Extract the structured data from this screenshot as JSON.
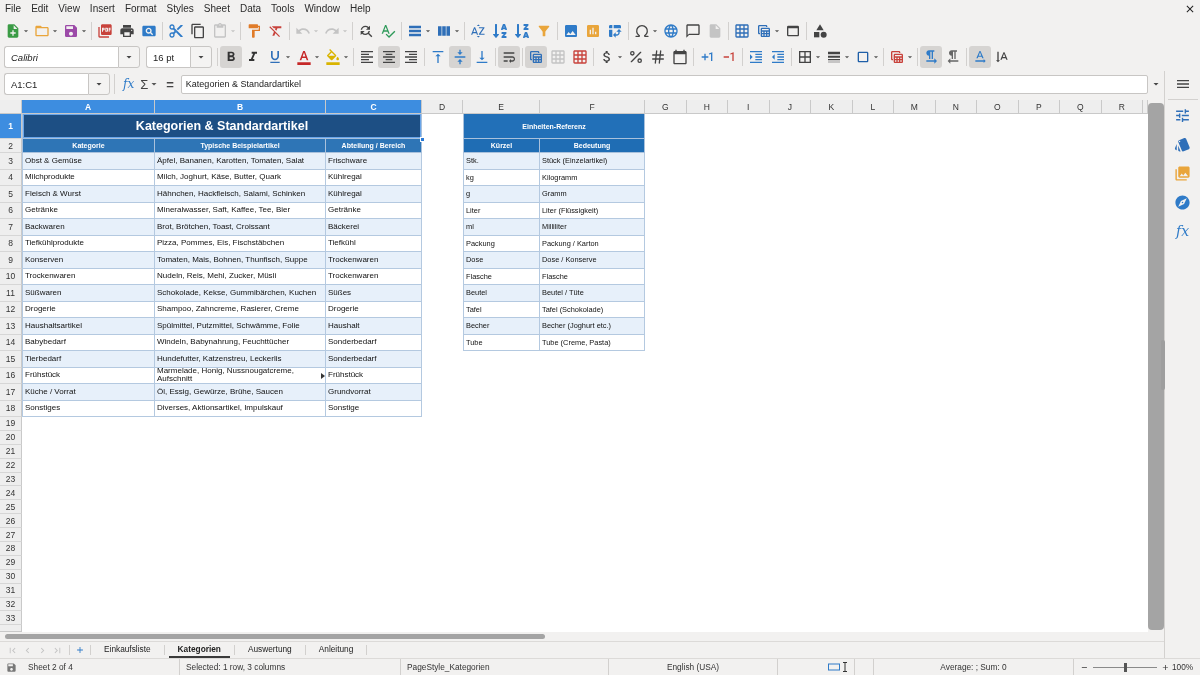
{
  "menu_bar": [
    "File",
    "Edit",
    "View",
    "Insert",
    "Format",
    "Styles",
    "Sheet",
    "Data",
    "Tools",
    "Window",
    "Help"
  ],
  "standard_toolbar": {
    "groups": [
      [
        {
          "kind": "new",
          "disabled": false
        },
        {
          "kind": "open",
          "disabled": false
        },
        {
          "kind": "save",
          "disabled": false
        }
      ],
      [
        {
          "kind": "export-pdf",
          "disabled": false
        },
        {
          "kind": "print",
          "disabled": false
        },
        {
          "kind": "print-preview",
          "disabled": false
        }
      ],
      [
        {
          "kind": "cut",
          "disabled": false
        },
        {
          "kind": "copy",
          "disabled": false
        },
        {
          "kind": "paste",
          "disabled": true
        }
      ],
      [
        {
          "kind": "clone-formatting",
          "disabled": false
        },
        {
          "kind": "clear-formatting",
          "disabled": false
        }
      ],
      [
        {
          "kind": "undo",
          "disabled": true
        },
        {
          "kind": "redo",
          "disabled": true
        }
      ],
      [
        {
          "kind": "find-replace",
          "disabled": false
        },
        {
          "kind": "spelling",
          "disabled": false
        }
      ],
      [
        {
          "kind": "row",
          "disabled": false
        },
        {
          "kind": "column",
          "disabled": false
        }
      ],
      [
        {
          "kind": "sort",
          "disabled": false
        },
        {
          "kind": "sort-ascending",
          "disabled": false
        },
        {
          "kind": "sort-descending",
          "disabled": false
        },
        {
          "kind": "autofilter",
          "disabled": false
        }
      ],
      [
        {
          "kind": "image",
          "disabled": false
        },
        {
          "kind": "chart",
          "disabled": false
        },
        {
          "kind": "pivot-table",
          "disabled": false
        }
      ],
      [
        {
          "kind": "special-character",
          "disabled": false
        },
        {
          "kind": "hyperlink",
          "disabled": false
        },
        {
          "kind": "comment",
          "disabled": false
        },
        {
          "kind": "header-footer",
          "disabled": true
        }
      ],
      [
        {
          "kind": "print-area",
          "disabled": false
        },
        {
          "kind": "freeze",
          "disabled": false
        },
        {
          "kind": "split-window",
          "disabled": false
        }
      ],
      [
        {
          "kind": "shapes",
          "disabled": false
        }
      ]
    ]
  },
  "formatting_toolbar": {
    "font_name": "Calibri",
    "font_size": "16 pt",
    "groups": [
      [
        {
          "kind": "bold",
          "on": true,
          "disabled": false
        },
        {
          "kind": "italic",
          "on": false,
          "disabled": false
        },
        {
          "kind": "underline",
          "on": false,
          "disabled": false
        },
        {
          "kind": "font-color",
          "on": false,
          "disabled": false
        },
        {
          "kind": "highlight",
          "on": false,
          "disabled": false
        }
      ],
      [
        {
          "kind": "align-left",
          "on": false,
          "disabled": false
        },
        {
          "kind": "align-center",
          "on": true,
          "disabled": false
        },
        {
          "kind": "align-right",
          "on": false,
          "disabled": false
        }
      ],
      [
        {
          "kind": "align-top",
          "on": false,
          "disabled": false
        },
        {
          "kind": "align-middle",
          "on": true,
          "disabled": false
        },
        {
          "kind": "align-bottom",
          "on": false,
          "disabled": false
        }
      ],
      [
        {
          "kind": "wrap",
          "on": true,
          "disabled": false
        }
      ],
      [
        {
          "kind": "merge-center",
          "on": true,
          "disabled": false
        },
        {
          "kind": "merge",
          "on": false,
          "disabled": true
        },
        {
          "kind": "unmerge",
          "on": false,
          "disabled": false
        }
      ],
      [
        {
          "kind": "currency",
          "on": false,
          "disabled": false
        },
        {
          "kind": "percent",
          "on": false,
          "disabled": false
        },
        {
          "kind": "number",
          "on": false,
          "disabled": false
        },
        {
          "kind": "date",
          "on": false,
          "disabled": false
        }
      ],
      [
        {
          "kind": "add-decimal",
          "on": false,
          "disabled": false
        },
        {
          "kind": "delete-decimal",
          "on": false,
          "disabled": false
        }
      ],
      [
        {
          "kind": "indent",
          "on": false,
          "disabled": false
        },
        {
          "kind": "outdent",
          "on": false,
          "disabled": false
        }
      ],
      [
        {
          "kind": "borders",
          "on": false,
          "disabled": false
        },
        {
          "kind": "border-style",
          "on": false,
          "disabled": false
        },
        {
          "kind": "border-color",
          "on": false,
          "disabled": false
        }
      ],
      [
        {
          "kind": "conditional",
          "on": false,
          "disabled": false
        }
      ],
      [
        {
          "kind": "ltr",
          "on": true,
          "disabled": false
        },
        {
          "kind": "rtl",
          "on": false,
          "disabled": false
        }
      ],
      [
        {
          "kind": "text-ltr",
          "on": true,
          "disabled": false
        },
        {
          "kind": "vertical-text",
          "on": false,
          "disabled": false
        }
      ]
    ]
  },
  "formula_bar": {
    "name_box": "A1:C1",
    "function_wizard": "fx",
    "sum": "Σ",
    "equals": "=",
    "content": "Kategorien & Standardartikel"
  },
  "sheet": {
    "columns": [
      {
        "label": "A",
        "selected": true
      },
      {
        "label": "B",
        "selected": true
      },
      {
        "label": "C",
        "selected": true
      },
      {
        "label": "D",
        "selected": false
      },
      {
        "label": "E",
        "selected": false
      },
      {
        "label": "F",
        "selected": false
      },
      {
        "label": "G",
        "selected": false
      },
      {
        "label": "H",
        "selected": false
      },
      {
        "label": "I",
        "selected": false
      },
      {
        "label": "J",
        "selected": false
      },
      {
        "label": "K",
        "selected": false
      },
      {
        "label": "L",
        "selected": false
      },
      {
        "label": "M",
        "selected": false
      },
      {
        "label": "N",
        "selected": false
      },
      {
        "label": "O",
        "selected": false
      },
      {
        "label": "P",
        "selected": false
      },
      {
        "label": "Q",
        "selected": false
      },
      {
        "label": "R",
        "selected": false
      }
    ],
    "rows": [
      {
        "label": "1",
        "selected": true
      },
      {
        "label": "2",
        "selected": false
      },
      {
        "label": "3",
        "selected": false
      },
      {
        "label": "4",
        "selected": false
      },
      {
        "label": "5",
        "selected": false
      },
      {
        "label": "6",
        "selected": false
      },
      {
        "label": "7",
        "selected": false
      },
      {
        "label": "8",
        "selected": false
      },
      {
        "label": "9",
        "selected": false
      },
      {
        "label": "10",
        "selected": false
      },
      {
        "label": "11",
        "selected": false
      },
      {
        "label": "12",
        "selected": false
      },
      {
        "label": "13",
        "selected": false
      },
      {
        "label": "14",
        "selected": false
      },
      {
        "label": "15",
        "selected": false
      },
      {
        "label": "16",
        "selected": false
      },
      {
        "label": "17",
        "selected": false
      },
      {
        "label": "18",
        "selected": false
      },
      {
        "label": "19",
        "selected": false
      },
      {
        "label": "20",
        "selected": false
      },
      {
        "label": "21",
        "selected": false
      },
      {
        "label": "22",
        "selected": false
      },
      {
        "label": "23",
        "selected": false
      },
      {
        "label": "24",
        "selected": false
      },
      {
        "label": "25",
        "selected": false
      },
      {
        "label": "26",
        "selected": false
      },
      {
        "label": "27",
        "selected": false
      },
      {
        "label": "28",
        "selected": false
      },
      {
        "label": "29",
        "selected": false
      },
      {
        "label": "30",
        "selected": false
      },
      {
        "label": "31",
        "selected": false
      },
      {
        "label": "32",
        "selected": false
      },
      {
        "label": "33",
        "selected": false
      }
    ],
    "category_table": {
      "title": {
        "text": "Kategorien & Standardartikel",
        "selected": true
      },
      "headers": [
        "Kategorie",
        "Typische Beispielartikel",
        "Abteilung / Bereich"
      ],
      "rows": [
        {
          "category": "Obst & Gemüse",
          "examples": "Äpfel, Bananen, Karotten, Tomaten, Salat",
          "department": "Frischware",
          "overflow": false
        },
        {
          "category": "Milchprodukte",
          "examples": "Milch, Joghurt, Käse, Butter, Quark",
          "department": "Kühlregal",
          "overflow": false
        },
        {
          "category": "Fleisch & Wurst",
          "examples": "Hähnchen, Hackfleisch, Salami, Schinken",
          "department": "Kühlregal",
          "overflow": false
        },
        {
          "category": "Getränke",
          "examples": "Mineralwasser, Saft, Kaffee, Tee, Bier",
          "department": "Getränke",
          "overflow": false
        },
        {
          "category": "Backwaren",
          "examples": "Brot, Brötchen, Toast, Croissant",
          "department": "Bäckerei",
          "overflow": false
        },
        {
          "category": "Tiefkühlprodukte",
          "examples": "Pizza, Pommes, Eis, Fischstäbchen",
          "department": "Tiefkühl",
          "overflow": false
        },
        {
          "category": "Konserven",
          "examples": "Tomaten, Mais, Bohnen, Thunfisch, Suppe",
          "department": "Trockenwaren",
          "overflow": false
        },
        {
          "category": "Trockenwaren",
          "examples": "Nudeln, Reis, Mehl, Zucker, Müsli",
          "department": "Trockenwaren",
          "overflow": false
        },
        {
          "category": "Süßwaren",
          "examples": "Schokolade, Kekse, Gummibärchen, Kuchen",
          "department": "Süßes",
          "overflow": false
        },
        {
          "category": "Drogerie",
          "examples": "Shampoo, Zahncreme, Rasierer, Creme",
          "department": "Drogerie",
          "overflow": false
        },
        {
          "category": "Haushaltsartikel",
          "examples": "Spülmittel, Putzmittel, Schwämme, Folie",
          "department": "Haushalt",
          "overflow": false
        },
        {
          "category": "Babybedarf",
          "examples": "Windeln, Babynahrung, Feuchttücher",
          "department": "Sonderbedarf",
          "overflow": false
        },
        {
          "category": "Tierbedarf",
          "examples": "Hundefutter, Katzenstreu, Leckerlis",
          "department": "Sonderbedarf",
          "overflow": false
        },
        {
          "category": "Frühstück",
          "examples": "Marmelade, Honig, Nussnougatcreme, Aufschnitt",
          "department": "Frühstück",
          "overflow": true
        },
        {
          "category": "Küche / Vorrat",
          "examples": "Öl, Essig, Gewürze, Brühe, Saucen",
          "department": "Grundvorrat",
          "overflow": false
        },
        {
          "category": "Sonstiges",
          "examples": "Diverses, Aktionsartikel, Impulskauf",
          "department": "Sonstige",
          "overflow": false
        }
      ]
    },
    "units_table": {
      "title": "Einheiten-Referenz",
      "headers": [
        "Kürzel",
        "Bedeutung"
      ],
      "rows": [
        {
          "abbreviation": "Stk.",
          "meaning": "Stück (Einzelartikel)"
        },
        {
          "abbreviation": "kg",
          "meaning": "Kilogramm"
        },
        {
          "abbreviation": "g",
          "meaning": "Gramm"
        },
        {
          "abbreviation": "Liter",
          "meaning": "Liter (Flüssigkeit)"
        },
        {
          "abbreviation": "ml",
          "meaning": "Milliliter"
        },
        {
          "abbreviation": "Packung",
          "meaning": "Packung / Karton"
        },
        {
          "abbreviation": "Dose",
          "meaning": "Dose / Konserve"
        },
        {
          "abbreviation": "Flasche",
          "meaning": "Flasche"
        },
        {
          "abbreviation": "Beutel",
          "meaning": "Beutel / Tüte"
        },
        {
          "abbreviation": "Tafel",
          "meaning": "Tafel (Schokolade)"
        },
        {
          "abbreviation": "Becher",
          "meaning": "Becher (Joghurt etc.)"
        },
        {
          "abbreviation": "Tube",
          "meaning": "Tube (Creme, Pasta)"
        }
      ]
    }
  },
  "sidebar": {
    "tabs": [
      {
        "kind": "properties"
      },
      {
        "kind": "styles"
      },
      {
        "kind": "gallery"
      },
      {
        "kind": "navigator"
      },
      {
        "kind": "functions",
        "label": "fx"
      }
    ]
  },
  "sheet_nav": [
    {
      "kind": "first",
      "disabled": true
    },
    {
      "kind": "previous",
      "disabled": true
    },
    {
      "kind": "next",
      "disabled": true
    },
    {
      "kind": "last",
      "disabled": true
    }
  ],
  "sheet_tabs": [
    {
      "label": "Einkaufsliste",
      "selected": false
    },
    {
      "label": "Kategorien",
      "selected": true
    },
    {
      "label": "Auswertung",
      "selected": false
    },
    {
      "label": "Anleitung",
      "selected": false
    }
  ],
  "status_bar": {
    "sheet": "Sheet 2 of 4",
    "selection": "Selected: 1 row, 3 columns",
    "page_style": "PageStyle_Kategorien",
    "language": "English (USA)",
    "summary": "Average: ; Sum: 0",
    "zoom_slider": {
      "level": 0.5
    },
    "zoom": "100%"
  }
}
